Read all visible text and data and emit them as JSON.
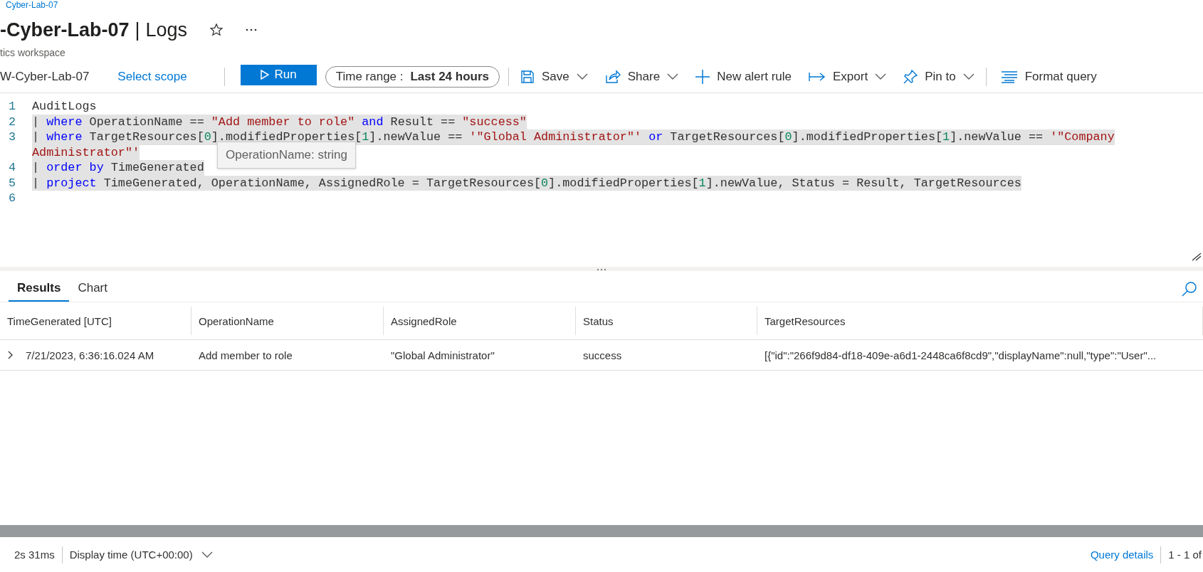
{
  "breadcrumb": "Cyber-Lab-07",
  "header": {
    "title": "-Cyber-Lab-07",
    "separator": "|",
    "page": "Logs",
    "subtitle": "tics workspace"
  },
  "toolbar": {
    "scope": "W-Cyber-Lab-07",
    "select_scope": "Select scope",
    "run": "Run",
    "time_range_label": "Time range :",
    "time_range_value": "Last 24 hours",
    "actions": [
      {
        "label": "Save",
        "dropdown": true
      },
      {
        "label": "Share",
        "dropdown": true
      },
      {
        "label": "New alert rule",
        "dropdown": false
      },
      {
        "label": "Export",
        "dropdown": true
      },
      {
        "label": "Pin to",
        "dropdown": true
      },
      {
        "label": "Format query",
        "dropdown": false
      }
    ]
  },
  "editor": {
    "lines": [
      {
        "number": "1",
        "selected": false,
        "tokens": [
          {
            "kind": "plain",
            "text": "AuditLogs"
          }
        ]
      },
      {
        "number": "2",
        "selected": true,
        "tokens": [
          {
            "kind": "plain",
            "text": "| "
          },
          {
            "kind": "keyword",
            "text": "where"
          },
          {
            "kind": "plain",
            "text": " OperationName == "
          },
          {
            "kind": "string",
            "text": "\"Add member to role\""
          },
          {
            "kind": "keyword",
            "text": " and"
          },
          {
            "kind": "plain",
            "text": " Result == "
          },
          {
            "kind": "string",
            "text": "\"success\""
          }
        ]
      },
      {
        "number": "3",
        "selected": true,
        "tokens": [
          {
            "kind": "plain",
            "text": "| "
          },
          {
            "kind": "keyword",
            "text": "where"
          },
          {
            "kind": "plain",
            "text": " TargetResources["
          },
          {
            "kind": "number",
            "text": "0"
          },
          {
            "kind": "plain",
            "text": "].modifiedProperties["
          },
          {
            "kind": "number",
            "text": "1"
          },
          {
            "kind": "plain",
            "text": "].newValue == "
          },
          {
            "kind": "string",
            "text": "'\"Global Administrator\"'"
          },
          {
            "kind": "keyword",
            "text": " or"
          },
          {
            "kind": "plain",
            "text": " TargetResources["
          },
          {
            "kind": "number",
            "text": "0"
          },
          {
            "kind": "plain",
            "text": "].modifiedProperties["
          },
          {
            "kind": "number",
            "text": "1"
          },
          {
            "kind": "plain",
            "text": "].newValue == "
          },
          {
            "kind": "string",
            "text": "'\"Company"
          }
        ]
      },
      {
        "selected": true,
        "tokens": [
          {
            "kind": "string",
            "text": "Administrator\"'"
          }
        ]
      },
      {
        "number": "4",
        "selected": true,
        "tokens": [
          {
            "kind": "plain",
            "text": "| "
          },
          {
            "kind": "keyword",
            "text": "order"
          },
          {
            "kind": "keyword",
            "text": " by"
          },
          {
            "kind": "plain",
            "text": " TimeGenerated"
          }
        ]
      },
      {
        "number": "5",
        "selected": true,
        "tokens": [
          {
            "kind": "plain",
            "text": "| "
          },
          {
            "kind": "keyword",
            "text": "project"
          },
          {
            "kind": "plain",
            "text": " TimeGenerated, OperationName, AssignedRole = TargetResources["
          },
          {
            "kind": "number",
            "text": "0"
          },
          {
            "kind": "plain",
            "text": "].modifiedProperties["
          },
          {
            "kind": "number",
            "text": "1"
          },
          {
            "kind": "plain",
            "text": "].newValue, Status = Result, TargetResources"
          }
        ]
      },
      {
        "number": "6"
      }
    ],
    "tooltip": "OperationName: string"
  },
  "results": {
    "tabs": [
      {
        "label": "Results",
        "selected": true
      },
      {
        "label": "Chart",
        "selected": false
      }
    ],
    "columns": [
      "TimeGenerated [UTC]",
      "OperationName",
      "AssignedRole",
      "Status",
      "TargetResources"
    ],
    "rows": [
      {
        "expanded": false,
        "cells": [
          "7/21/2023, 6:36:16.024 AM",
          "Add member to role",
          "\"Global Administrator\"",
          "success",
          "[{\"id\":\"266f9d84-df18-409e-a6d1-2448ca6f8cd9\",\"displayName\":null,\"type\":\"User\"..."
        ]
      }
    ]
  },
  "status_bar": {
    "duration": "2s 31ms",
    "display_time": "Display time (UTC+00:00)",
    "query_details": "Query details",
    "paging": "1 - 1 of"
  }
}
